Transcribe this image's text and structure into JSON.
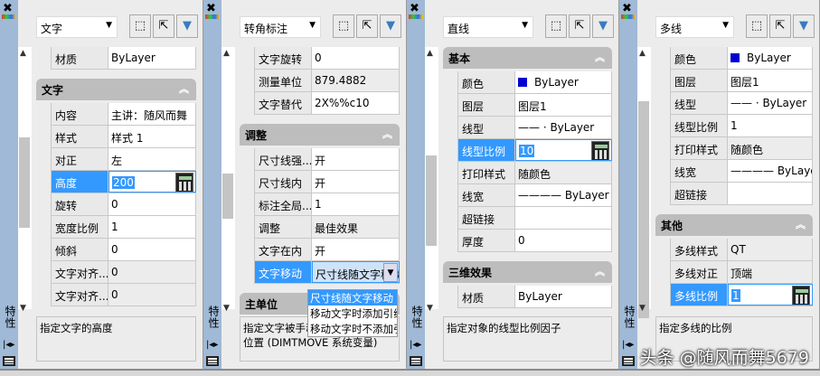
{
  "panels": [
    {
      "strip_label": "特性",
      "type_select": "文字",
      "sections": [
        {
          "title": null,
          "rows": [
            {
              "k": "材质",
              "v": "ByLayer"
            }
          ]
        },
        {
          "title": "文字",
          "rows": [
            {
              "k": "内容",
              "v": "主讲：随风而舞"
            },
            {
              "k": "样式",
              "v": "样式 1"
            },
            {
              "k": "对正",
              "v": "左"
            },
            {
              "k": "高度",
              "v": "200",
              "selected": true,
              "calc": true
            },
            {
              "k": "旋转",
              "v": "0"
            },
            {
              "k": "宽度比例",
              "v": "1"
            },
            {
              "k": "倾斜",
              "v": "0"
            },
            {
              "k": "文字对齐...",
              "v": "0",
              "ro": true
            },
            {
              "k": "文字对齐...",
              "v": "0",
              "ro": true
            }
          ]
        }
      ],
      "description": "指定文字的高度"
    },
    {
      "strip_label": "特性",
      "type_select": "转角标注",
      "sections": [
        {
          "title": null,
          "rows": [
            {
              "k": "文字旋转",
              "v": "0"
            },
            {
              "k": "测量单位",
              "v": "879.4882",
              "ro": true
            },
            {
              "k": "文字替代",
              "v": "2X%%c10"
            }
          ]
        },
        {
          "title": "调整",
          "rows": [
            {
              "k": "尺寸线强...",
              "v": "开"
            },
            {
              "k": "尺寸线内",
              "v": "开"
            },
            {
              "k": "标注全局...",
              "v": "1"
            },
            {
              "k": "调整",
              "v": "最佳效果",
              "ro": true
            },
            {
              "k": "文字在内",
              "v": "开"
            },
            {
              "k": "文字移动",
              "v": "尺寸线随文字移动",
              "selected": true,
              "dropdown": true
            }
          ]
        },
        {
          "title": "主单位",
          "rows": []
        }
      ],
      "dropdown_options": [
        "尺寸线随文字移动",
        "移动文字时添加引线",
        "移动文字时不添加引线"
      ],
      "description": "指定文字被手动移动时的\n位置 (DIMTMOVE 系统变量)"
    },
    {
      "strip_label": "特性",
      "type_select": "直线",
      "sections": [
        {
          "title": "基本",
          "rows": [
            {
              "k": "颜色",
              "v": "ByLayer",
              "swatch": true
            },
            {
              "k": "图层",
              "v": "图层1"
            },
            {
              "k": "线型",
              "v": "——     · ByLayer"
            },
            {
              "k": "线型比例",
              "v": "10",
              "selected": true,
              "calc": true
            },
            {
              "k": "打印样式",
              "v": "随颜色",
              "ro": true
            },
            {
              "k": "线宽",
              "v": "———— ByLayer"
            },
            {
              "k": "超链接",
              "v": ""
            },
            {
              "k": "厚度",
              "v": "0"
            }
          ]
        },
        {
          "title": "三维效果",
          "rows": [
            {
              "k": "材质",
              "v": "ByLayer"
            }
          ]
        }
      ],
      "description": "指定对象的线型比例因子"
    },
    {
      "strip_label": "特性",
      "type_select": "多线",
      "sections": [
        {
          "title": null,
          "rows": [
            {
              "k": "颜色",
              "v": "ByLayer",
              "swatch": true
            },
            {
              "k": "图层",
              "v": "图层1"
            },
            {
              "k": "线型",
              "v": "——     · ByLayer"
            },
            {
              "k": "线型比例",
              "v": "1"
            },
            {
              "k": "打印样式",
              "v": "随颜色",
              "ro": true
            },
            {
              "k": "线宽",
              "v": "———— ByLayer"
            },
            {
              "k": "超链接",
              "v": ""
            }
          ]
        },
        {
          "title": "其他",
          "rows": [
            {
              "k": "多线样式",
              "v": "QT",
              "ro": true
            },
            {
              "k": "多线对正",
              "v": "顶端",
              "ro": true
            },
            {
              "k": "多线比例",
              "v": "1",
              "selected": true,
              "calc": true
            }
          ]
        }
      ],
      "description": "指定多线的比例"
    }
  ],
  "watermark": "头条 @随风而舞5679",
  "colors": {
    "accent": "#3399ff",
    "strip": "#9fb9d6",
    "swatch": "#0000d0"
  }
}
